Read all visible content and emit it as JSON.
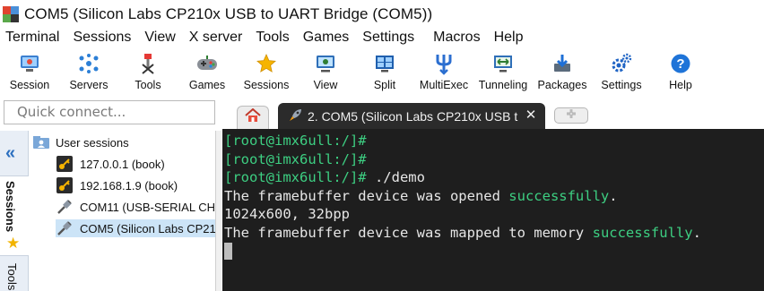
{
  "window": {
    "title": "COM5  (Silicon Labs CP210x USB to UART Bridge (COM5))"
  },
  "menu": [
    "Terminal",
    "Sessions",
    "View",
    "X server",
    "Tools",
    "Games",
    "Settings",
    "Macros",
    "Help"
  ],
  "toolbar": [
    {
      "label": "Session",
      "icon": "session-icon"
    },
    {
      "label": "Servers",
      "icon": "servers-icon"
    },
    {
      "label": "Tools",
      "icon": "tools-icon"
    },
    {
      "label": "Games",
      "icon": "games-icon"
    },
    {
      "label": "Sessions",
      "icon": "star-icon"
    },
    {
      "label": "View",
      "icon": "view-icon"
    },
    {
      "label": "Split",
      "icon": "split-icon"
    },
    {
      "label": "MultiExec",
      "icon": "multiexec-icon"
    },
    {
      "label": "Tunneling",
      "icon": "tunneling-icon"
    },
    {
      "label": "Packages",
      "icon": "packages-icon"
    },
    {
      "label": "Settings",
      "icon": "gears-icon"
    },
    {
      "label": "Help",
      "icon": "help-icon"
    }
  ],
  "quick_connect": {
    "placeholder": "Quick connect..."
  },
  "tabs": {
    "session_tab_label": "2. COM5  (Silicon Labs CP210x USB t",
    "close_glyph": "✕"
  },
  "sidebar": {
    "collapse_glyph": "«",
    "sessions_tab": "Sessions",
    "tools_tab": "Tools",
    "root_label": "User sessions",
    "items": [
      {
        "label": "127.0.0.1 (book)",
        "icon": "key-icon"
      },
      {
        "label": "192.168.1.9 (book)",
        "icon": "key-icon"
      },
      {
        "label": "COM11  (USB-SERIAL CH34",
        "icon": "serial-plug-icon"
      },
      {
        "label": "COM5  (Silicon Labs CP210",
        "icon": "serial-plug-icon"
      }
    ]
  },
  "terminal": {
    "prompt": "[root@imx6ull:/]#",
    "command": " ./demo",
    "line4_prefix": "The framebuffer device was opened ",
    "line4_ok": "successfully",
    "line4_suffix": ".",
    "line5": "1024x600, 32bpp",
    "line6_prefix": "The framebuffer device was mapped to memory ",
    "line6_ok": "successfully",
    "line6_suffix": "."
  },
  "colors": {
    "terminal_bg": "#1e1e1e",
    "prompt_green": "#3dcf82",
    "active_tab": "#2b2b2b",
    "selection": "#cce4f7"
  }
}
